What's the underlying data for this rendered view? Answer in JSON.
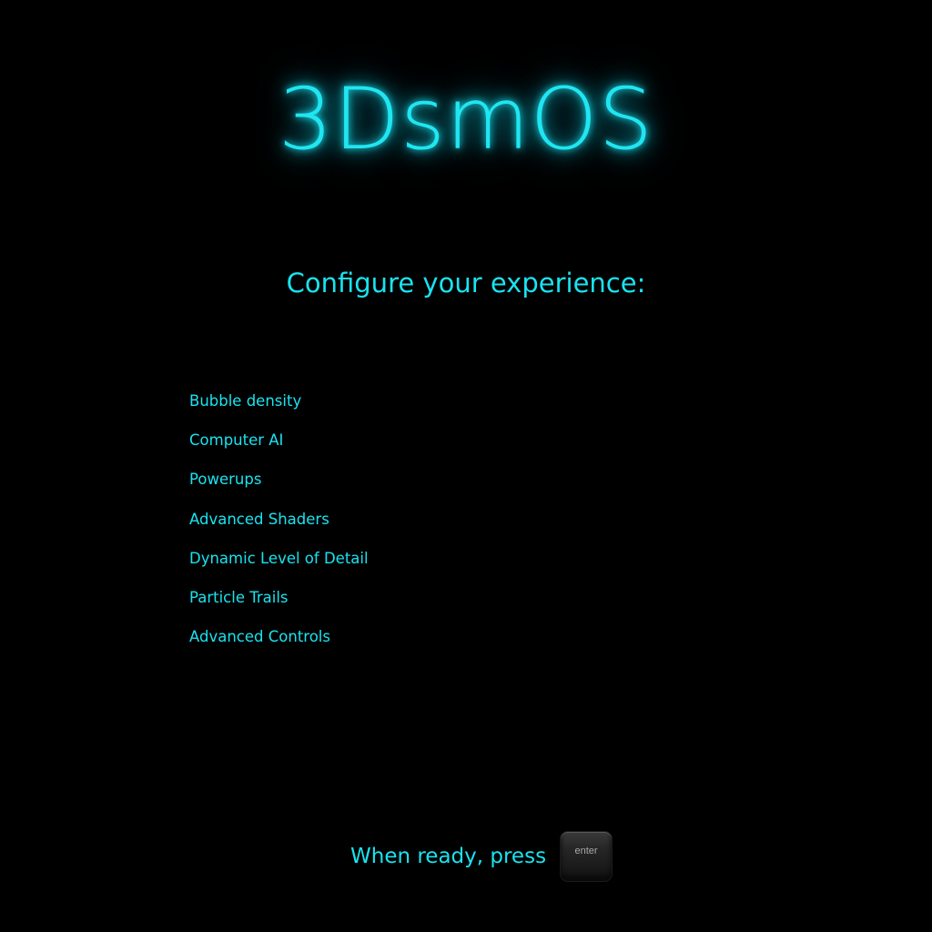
{
  "app": {
    "title": "3DsmOS",
    "accent_color": "#19e3f0",
    "background_color": "#000000"
  },
  "subtitle": "Configure your experience:",
  "options": [
    {
      "label": "Bubble density"
    },
    {
      "label": "Computer AI"
    },
    {
      "label": "Powerups"
    },
    {
      "label": "Advanced Shaders"
    },
    {
      "label": "Dynamic Level of Detail"
    },
    {
      "label": "Particle Trails"
    },
    {
      "label": "Advanced Controls"
    }
  ],
  "footer": {
    "text": "When ready, press",
    "key_label": "enter",
    "key_icon": "enter-key-icon"
  }
}
